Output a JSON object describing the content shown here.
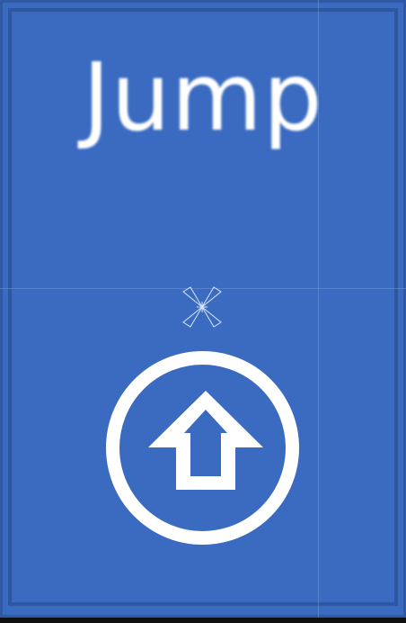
{
  "button": {
    "label": "Jump",
    "icon": "arrow-up-circle-icon"
  },
  "colors": {
    "background": "#3a6bc1",
    "border": "#2f5aa3",
    "foreground": "#ffffff"
  }
}
